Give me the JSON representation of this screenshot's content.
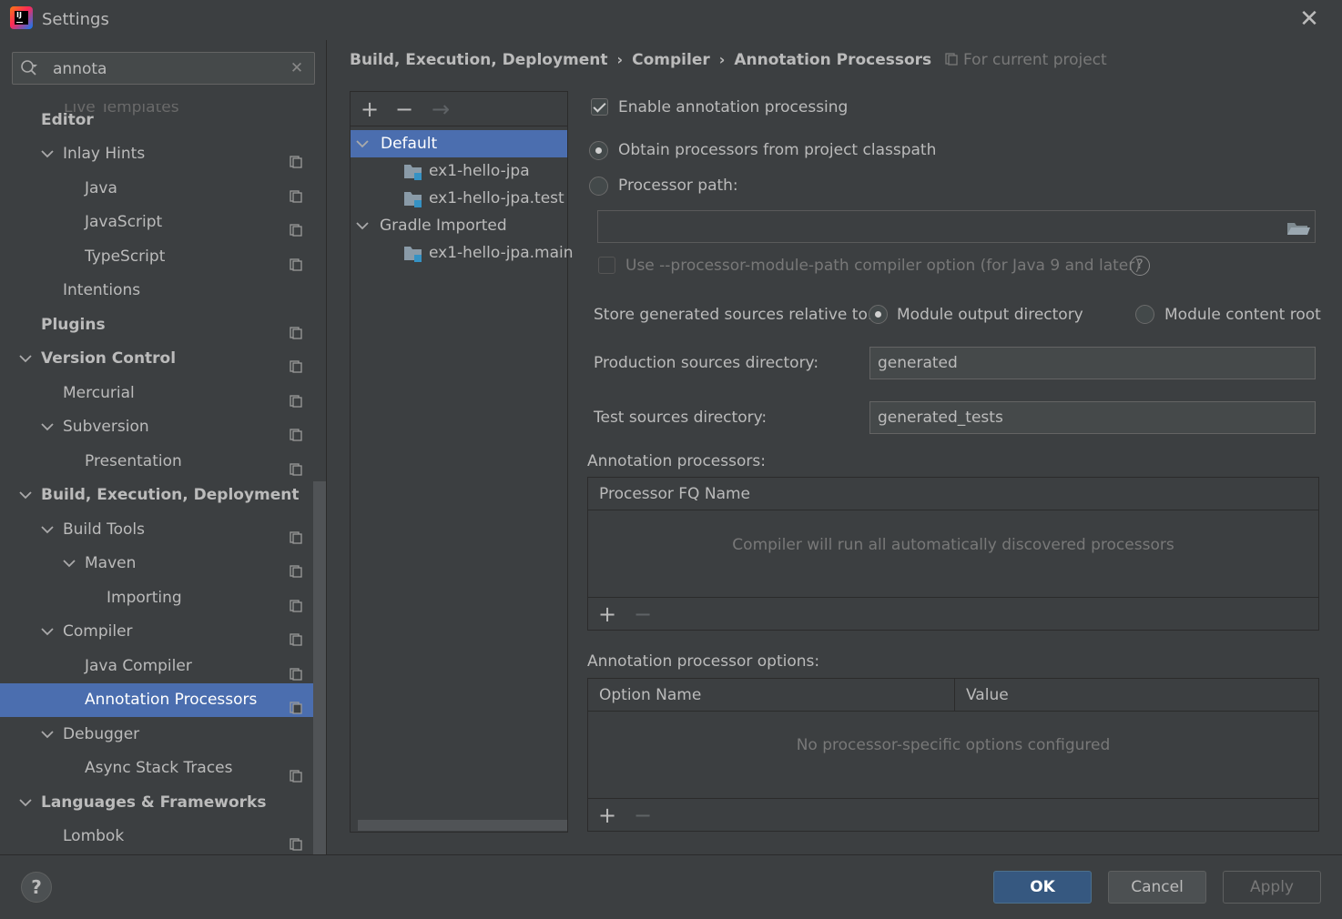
{
  "window": {
    "title": "Settings",
    "close_glyph": "✕"
  },
  "search": {
    "value": "annota",
    "placeholder": "",
    "clear_glyph": "✕"
  },
  "sidebar": {
    "ghost_text": "Live Templates",
    "items": [
      {
        "label": "Editor",
        "bold": true
      },
      {
        "label": "Inlay Hints"
      },
      {
        "label": "Java"
      },
      {
        "label": "JavaScript"
      },
      {
        "label": "TypeScript"
      },
      {
        "label": "Intentions"
      },
      {
        "label": "Plugins",
        "bold": true
      },
      {
        "label": "Version Control",
        "bold": true
      },
      {
        "label": "Mercurial"
      },
      {
        "label": "Subversion"
      },
      {
        "label": "Presentation"
      },
      {
        "label": "Build, Execution, Deployment",
        "bold": true
      },
      {
        "label": "Build Tools"
      },
      {
        "label": "Maven"
      },
      {
        "label": "Importing"
      },
      {
        "label": "Compiler"
      },
      {
        "label": "Java Compiler"
      },
      {
        "label": "Annotation Processors",
        "selected": true
      },
      {
        "label": "Debugger"
      },
      {
        "label": "Async Stack Traces"
      },
      {
        "label": "Languages & Frameworks",
        "bold": true
      },
      {
        "label": "Lombok"
      }
    ]
  },
  "breadcrumb": {
    "items": [
      "Build, Execution, Deployment",
      "Compiler",
      "Annotation Processors"
    ],
    "separator": "›",
    "scope_label": "For current project"
  },
  "profiles": {
    "toolbar": {
      "add": "+",
      "remove": "−",
      "move": "→"
    },
    "items": [
      {
        "label": "Default",
        "selected": true
      },
      {
        "label": "ex1-hello-jpa"
      },
      {
        "label": "ex1-hello-jpa.test"
      },
      {
        "label": "Gradle Imported"
      },
      {
        "label": "ex1-hello-jpa.main"
      }
    ]
  },
  "settings": {
    "enable_processing": {
      "label": "Enable annotation processing",
      "checked": true
    },
    "obtain_from_classpath": {
      "label": "Obtain processors from project classpath",
      "checked": true
    },
    "processor_path": {
      "label": "Processor path:",
      "checked": false,
      "value": ""
    },
    "module_path_option": {
      "label": "Use --processor-module-path compiler option (for Java 9 and later)",
      "checked": false,
      "help_glyph": "?"
    },
    "store_relative": {
      "label": "Store generated sources relative to:",
      "options": [
        {
          "label": "Module output directory",
          "checked": true
        },
        {
          "label": "Module content root",
          "checked": false
        }
      ]
    },
    "production_dir": {
      "label": "Production sources directory:",
      "value": "generated"
    },
    "test_dir": {
      "label": "Test sources directory:",
      "value": "generated_tests"
    }
  },
  "processors_table": {
    "title": "Annotation processors:",
    "column": "Processor FQ Name",
    "empty_text": "Compiler will run all automatically discovered processors",
    "add": "+",
    "remove": "−"
  },
  "options_table": {
    "title": "Annotation processor options:",
    "columns": [
      "Option Name",
      "Value"
    ],
    "empty_text": "No processor-specific options configured",
    "add": "+",
    "remove": "−"
  },
  "footer": {
    "help": "?",
    "ok": "OK",
    "cancel": "Cancel",
    "apply": "Apply"
  },
  "colors": {
    "background": "#3c3f41",
    "selection": "#4b6eaf",
    "primary_button": "#365880",
    "text": "#bbbbbb",
    "disabled_text": "#787878"
  }
}
